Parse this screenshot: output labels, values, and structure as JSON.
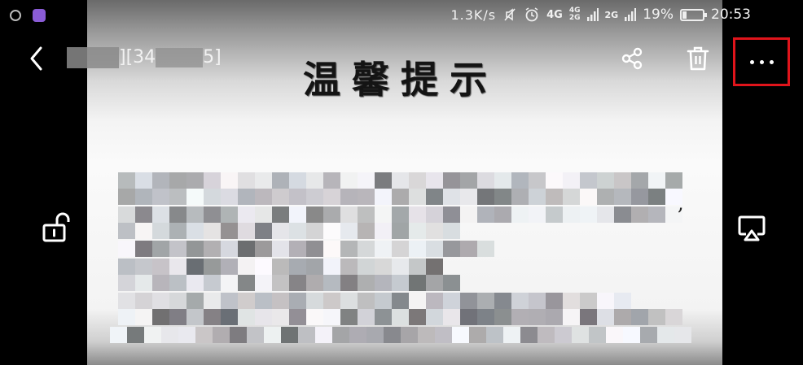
{
  "status_bar": {
    "network_speed": "1.3K/s",
    "network_type_1": "4G",
    "network_type_2": "4G",
    "network_type_3": "2G",
    "network_type_4": "2G",
    "battery_percent": "19%",
    "battery_level": 0.19,
    "time": "20:53"
  },
  "toolbar": {
    "file_name_prefix": "",
    "file_name_visible": "][34",
    "file_name_suffix": "5]",
    "highlight_color": "#e0141b"
  },
  "photo": {
    "title": "温馨提示",
    "punctuation": ","
  },
  "icons": {
    "back": "back-arrow-icon",
    "share": "share-icon",
    "delete": "trash-icon",
    "more": "more-dots-icon",
    "lock": "unlock-icon",
    "cast": "cast-screen-icon"
  }
}
